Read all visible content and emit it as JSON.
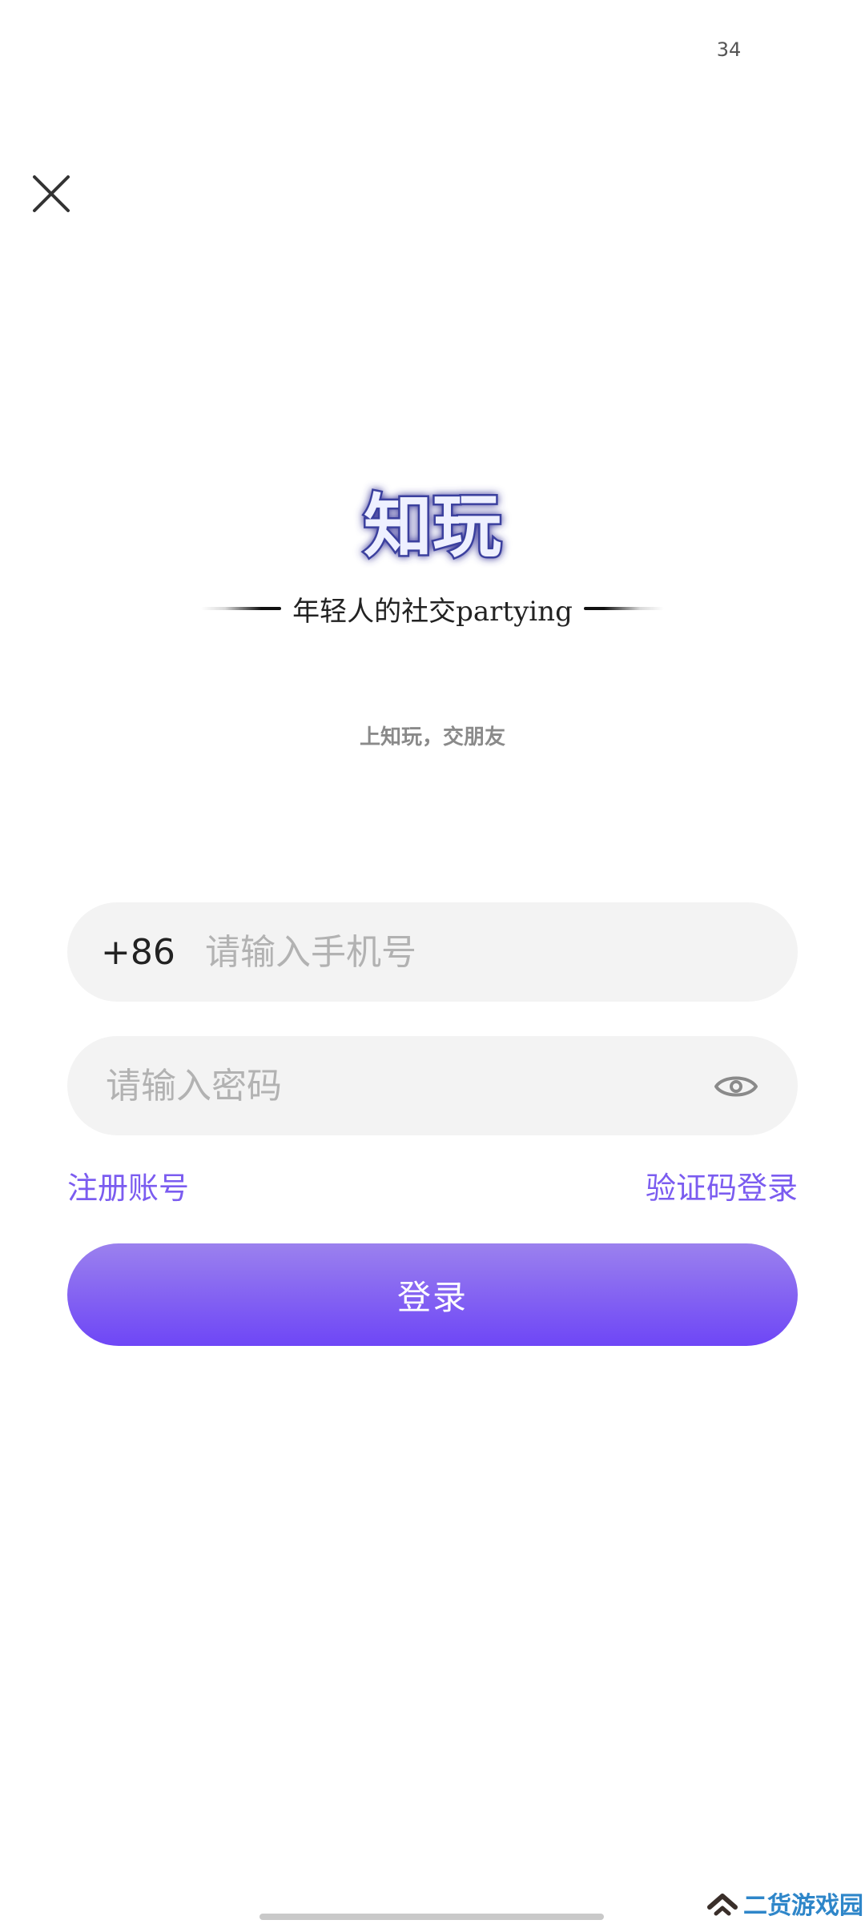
{
  "status_bar": {
    "time": "34"
  },
  "header": {
    "close_icon": "close-icon"
  },
  "logo": {
    "brand": "知玩",
    "slogan": "年轻人的社交partying",
    "tagline": "上知玩，交朋友"
  },
  "form": {
    "country_code": "+86",
    "phone_placeholder": "请输入手机号",
    "password_placeholder": "请输入密码",
    "eye_icon": "eye-icon",
    "register_label": "注册账号",
    "code_login_label": "验证码登录",
    "login_label": "登录"
  },
  "watermark": {
    "text": "二货游戏园"
  },
  "colors": {
    "accent": "#7b5cf0",
    "button_top": "#9b81ee",
    "button_bottom": "#6e46f6",
    "field_bg": "#f3f3f3"
  }
}
